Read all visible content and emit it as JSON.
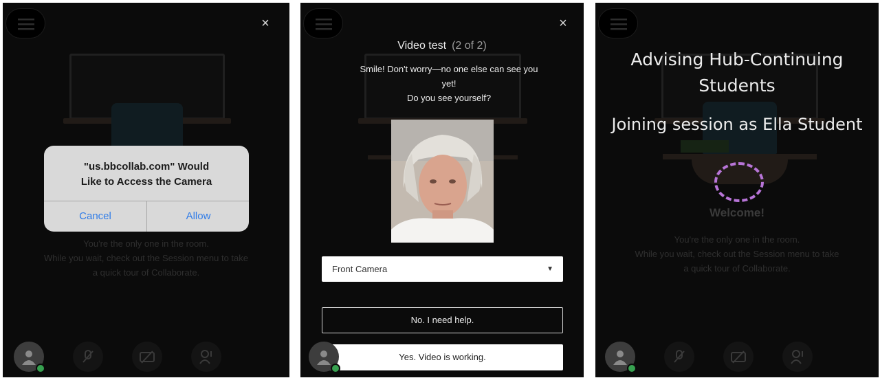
{
  "panel1": {
    "dialog": {
      "title_line1": "\"us.bbcollab.com\" Would",
      "title_line2": "Like to Access the Camera",
      "cancel_label": "Cancel",
      "allow_label": "Allow"
    },
    "background_text": {
      "line1": "You're the only one in the room.",
      "line2": "While you wait, check out the Session menu to take",
      "line3": "a quick tour of Collaborate."
    }
  },
  "panel2": {
    "title": "Video test",
    "step": "(2 of 2)",
    "message_line1": "Smile! Don't worry—no one else can see you",
    "message_line2": "yet!",
    "message_line3": "Do you see yourself?",
    "camera_select_value": "Front Camera",
    "help_button_label": "No. I need help.",
    "working_button_label": "Yes. Video is working."
  },
  "panel3": {
    "title_line1": "Advising Hub-Continuing",
    "title_line2": "Students",
    "joining_text": "Joining session as Ella Student",
    "welcome": "Welcome!",
    "info_line1": "You're the only one in the room.",
    "info_line2": "While you wait, check out the Session menu to take",
    "info_line3": "a quick tour of Collaborate."
  },
  "icons": {
    "close": "×",
    "dropdown_caret": "▼"
  },
  "colors": {
    "ios_link_blue": "#2f7ce8",
    "status_green": "#37a150",
    "welcome_ring_purple": "#b875d8"
  }
}
